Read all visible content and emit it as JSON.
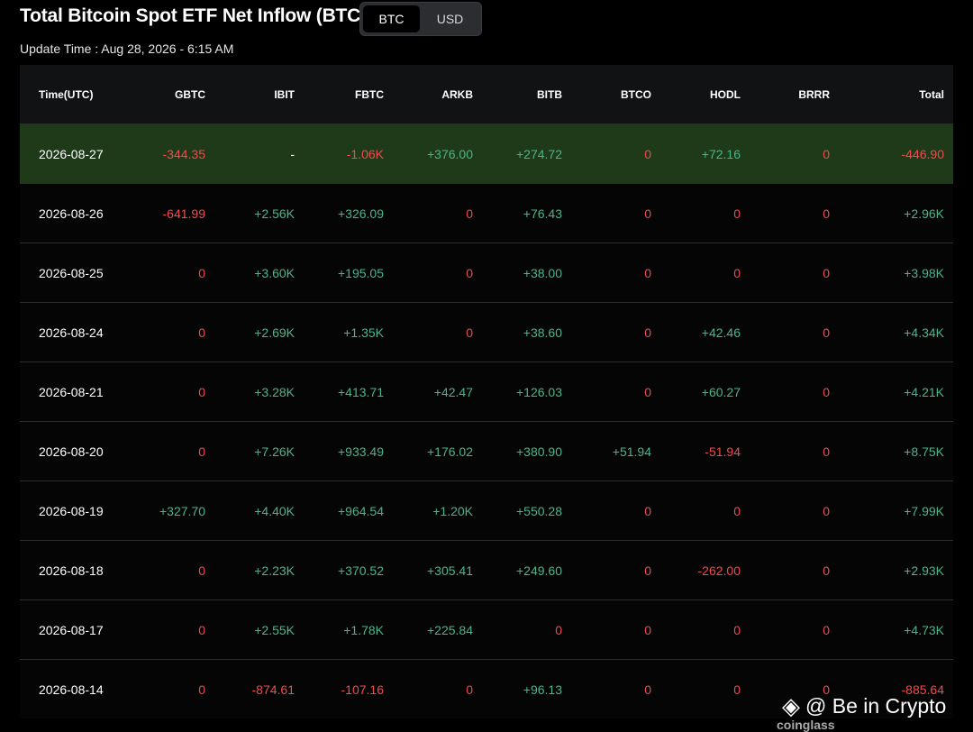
{
  "header": {
    "title": "Total Bitcoin Spot ETF Net Inflow (BTC)",
    "toggle": [
      {
        "label": "BTC",
        "active": true
      },
      {
        "label": "USD",
        "active": false
      }
    ],
    "update_label": "Update Time : ",
    "update_value": "Aug 28, 2026 - 6:15 AM"
  },
  "table": {
    "columns": [
      "Time(UTC)",
      "GBTC",
      "IBIT",
      "FBTC",
      "ARKB",
      "BITB",
      "BTCO",
      "HODL",
      "BRRR",
      "Total"
    ],
    "rows": [
      [
        "2026-08-27",
        "-344.35",
        "-",
        "-1.06K",
        "+376.00",
        "+274.72",
        "0",
        "+72.16",
        "0",
        "-446.90"
      ],
      [
        "2026-08-26",
        "-641.99",
        "+2.56K",
        "+326.09",
        "0",
        "+76.43",
        "0",
        "0",
        "0",
        "+2.96K"
      ],
      [
        "2026-08-25",
        "0",
        "+3.60K",
        "+195.05",
        "0",
        "+38.00",
        "0",
        "0",
        "0",
        "+3.98K"
      ],
      [
        "2026-08-24",
        "0",
        "+2.69K",
        "+1.35K",
        "0",
        "+38.60",
        "0",
        "+42.46",
        "0",
        "+4.34K"
      ],
      [
        "2026-08-21",
        "0",
        "+3.28K",
        "+413.71",
        "+42.47",
        "+126.03",
        "0",
        "+60.27",
        "0",
        "+4.21K"
      ],
      [
        "2026-08-20",
        "0",
        "+7.26K",
        "+933.49",
        "+176.02",
        "+380.90",
        "+51.94",
        "-51.94",
        "0",
        "+8.75K"
      ],
      [
        "2026-08-19",
        "+327.70",
        "+4.40K",
        "+964.54",
        "+1.20K",
        "+550.28",
        "0",
        "0",
        "0",
        "+7.99K"
      ],
      [
        "2026-08-18",
        "0",
        "+2.23K",
        "+370.52",
        "+305.41",
        "+249.60",
        "0",
        "-262.00",
        "0",
        "+2.93K"
      ],
      [
        "2026-08-17",
        "0",
        "+2.55K",
        "+1.78K",
        "+225.84",
        "0",
        "0",
        "0",
        "0",
        "+4.73K"
      ],
      [
        "2026-08-14",
        "0",
        "-874.61",
        "-107.16",
        "0",
        "+96.13",
        "0",
        "0",
        "0",
        "-885.64"
      ]
    ]
  },
  "watermark": {
    "text": "@ Be in Crypto",
    "icon": "binance-diamond-icon",
    "sub": "coinglass"
  },
  "colors": {
    "positive": "#4bb58a",
    "negative": "#ef4b4f",
    "highlight_row": "#1f3a18"
  }
}
